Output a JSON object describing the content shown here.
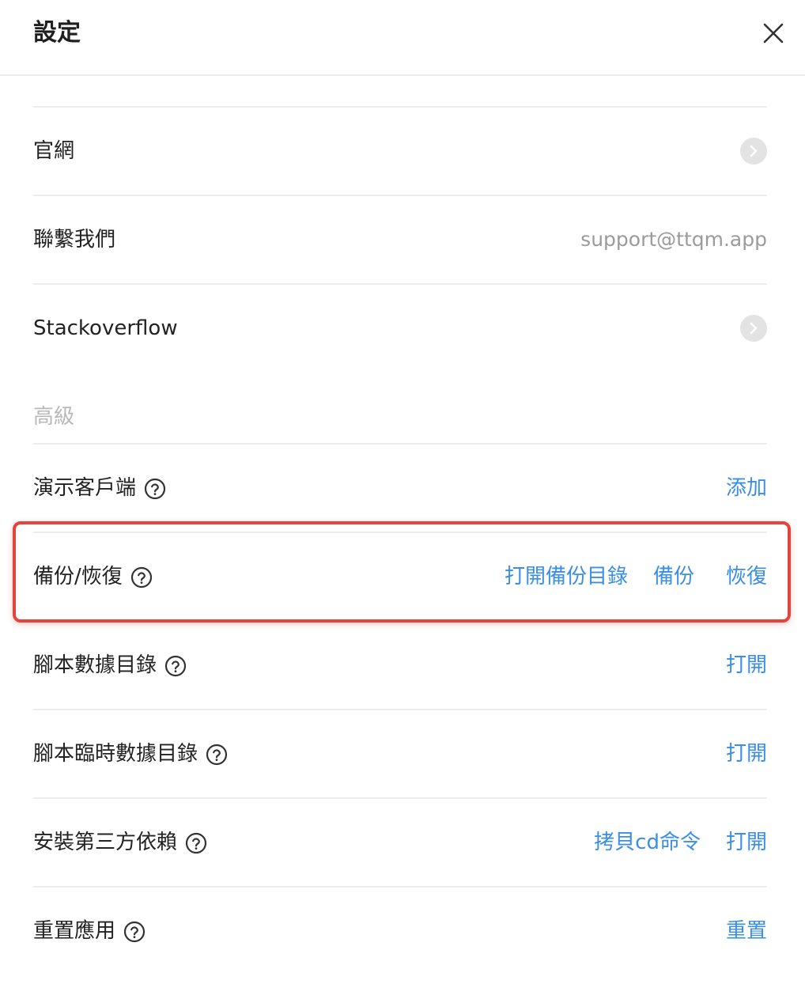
{
  "header": {
    "title": "設定"
  },
  "rows": {
    "website": {
      "label": "官網"
    },
    "contact": {
      "label": "聯繫我們",
      "value": "support@ttqm.app"
    },
    "stackoverflow": {
      "label": "Stackoverflow"
    },
    "advanced_section": "高級",
    "demo_client": {
      "label": "演示客戶端",
      "action": "添加"
    },
    "backup": {
      "label": "備份/恢復",
      "actions": [
        "打開備份目錄",
        "備份",
        "恢復"
      ]
    },
    "script_data_dir": {
      "label": "腳本數據目錄",
      "action": "打開"
    },
    "script_temp_dir": {
      "label": "腳本臨時數據目錄",
      "action": "打開"
    },
    "install_deps": {
      "label": "安裝第三方依賴",
      "actions": [
        "拷貝cd命令",
        "打開"
      ]
    },
    "reset_app": {
      "label": "重置應用",
      "action": "重置"
    }
  },
  "colors": {
    "link": "#3a8ee6",
    "highlight": "#e2453c"
  },
  "icons": {
    "close": "close-icon",
    "chevron": "chevron-right-icon",
    "help": "question-circle-icon"
  }
}
